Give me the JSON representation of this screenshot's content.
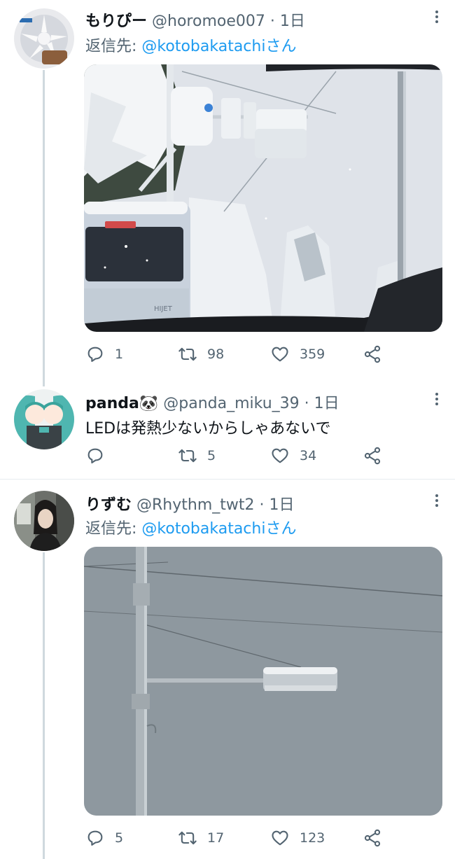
{
  "colors": {
    "link": "#1d9bf0",
    "secondary": "#536471",
    "text": "#0f1419",
    "line": "#cfd9de"
  },
  "tweets": [
    {
      "name": "もりぴー",
      "handle": "@horomoe007",
      "separator": "·",
      "time": "1日",
      "reply_prefix": "返信先: ",
      "reply_mention": "@kotobakatachiさん",
      "media": "snowy-road-with-traffic-signal",
      "replies": "1",
      "retweets": "98",
      "likes": "359"
    },
    {
      "name": "panda🐼",
      "handle": "@panda_miku_39",
      "separator": "·",
      "time": "1日",
      "text": "LEDは発熱少ないからしゃあないで",
      "replies": "",
      "retweets": "5",
      "likes": "34"
    },
    {
      "name": "りずむ",
      "handle": "@Rhythm_twt2",
      "separator": "·",
      "time": "1日",
      "reply_prefix": "返信先: ",
      "reply_mention": "@kotobakatachiさん",
      "media": "snow-covered-pole-and-signal-arm",
      "replies": "5",
      "retweets": "17",
      "likes": "123"
    }
  ]
}
